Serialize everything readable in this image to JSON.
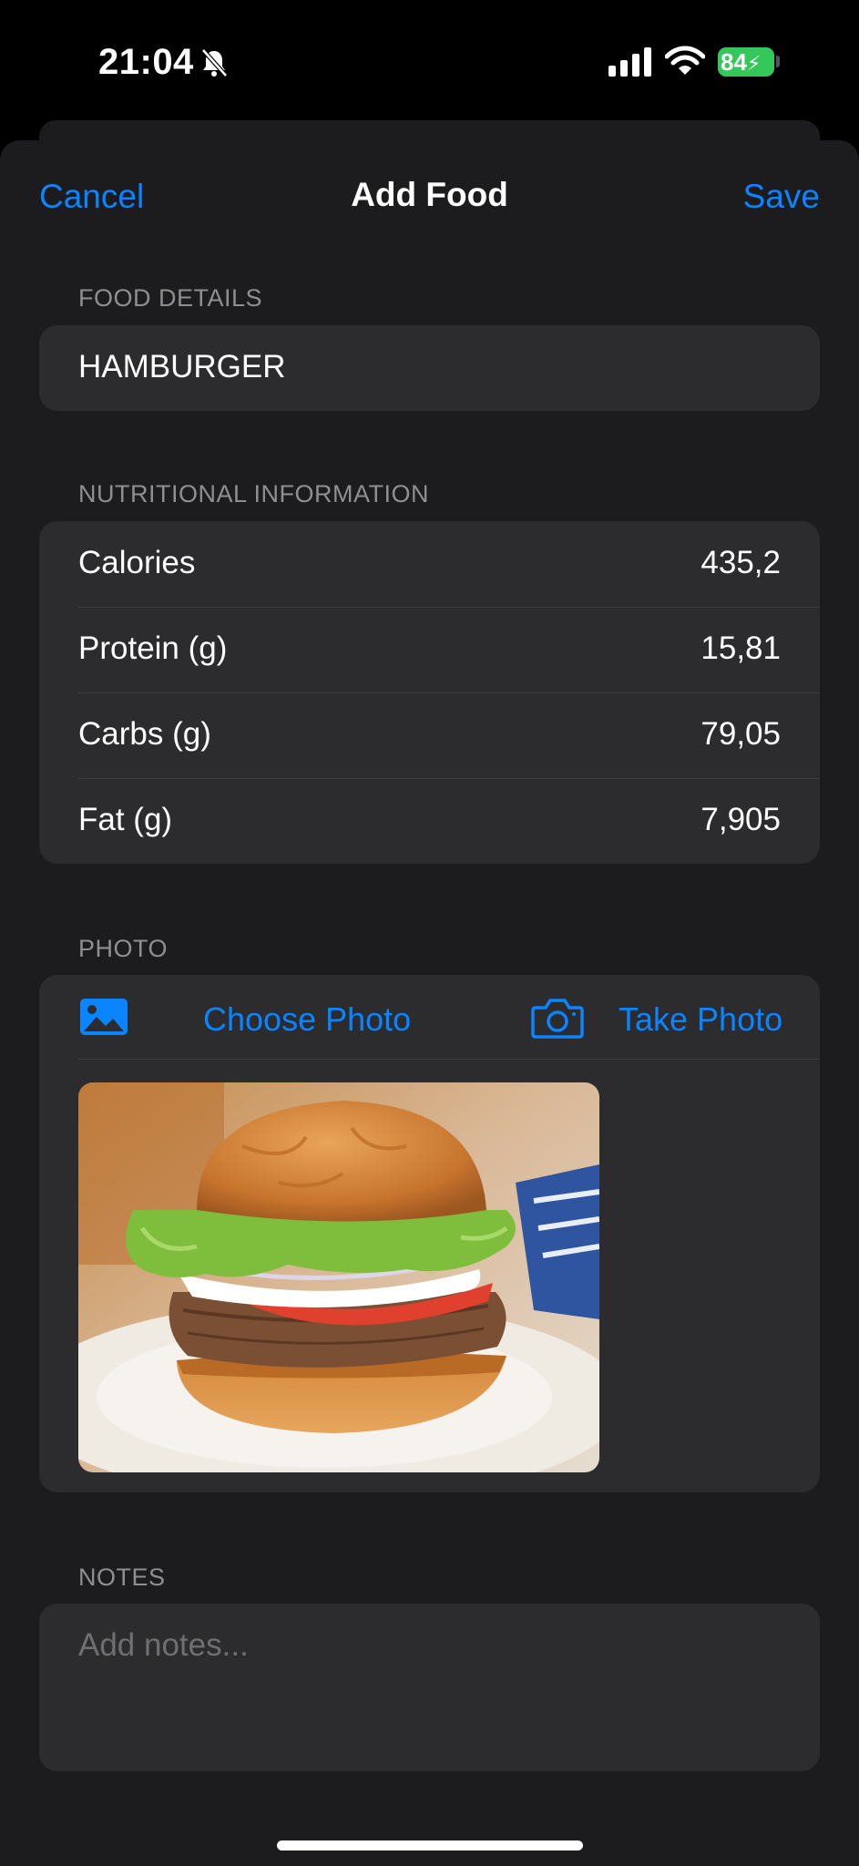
{
  "status_bar": {
    "time": "21:04",
    "battery_level": "84"
  },
  "nav": {
    "cancel_label": "Cancel",
    "title": "Add Food",
    "save_label": "Save"
  },
  "food_details": {
    "header": "FOOD DETAILS",
    "name_value": "HAMBURGER"
  },
  "nutrition": {
    "header": "NUTRITIONAL INFORMATION",
    "rows": [
      {
        "label": "Calories",
        "value": "435,2"
      },
      {
        "label": "Protein (g)",
        "value": "15,81"
      },
      {
        "label": "Carbs (g)",
        "value": "79,05"
      },
      {
        "label": "Fat (g)",
        "value": "7,905"
      }
    ]
  },
  "photo": {
    "header": "PHOTO",
    "choose_label": "Choose Photo",
    "take_label": "Take Photo",
    "choose_icon": "photo-icon",
    "take_icon": "camera-icon"
  },
  "notes": {
    "header": "NOTES",
    "placeholder": "Add notes..."
  },
  "colors": {
    "accent": "#0a84ff",
    "sheet_background": "#1c1c1e",
    "card_background": "#2c2c2e",
    "battery": "#34c759"
  }
}
